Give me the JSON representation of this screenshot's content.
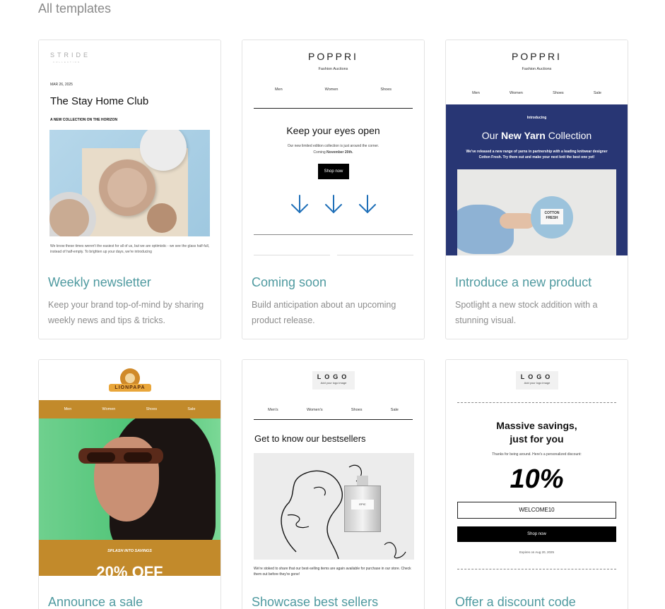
{
  "page": {
    "heading": "All templates"
  },
  "colors": {
    "title": "#4f9aa0",
    "description": "#8d8d8d",
    "navy": "#283674",
    "ochre": "#c28a2b",
    "arrow_blue": "#1e6fb8"
  },
  "templates": [
    {
      "title": "Weekly newsletter",
      "description": "Keep your brand top-of-mind by sharing weekly news and tips & tricks.",
      "preview": {
        "brand": "STRIDE",
        "brand_sub": "COLLECTION",
        "date": "MAR 26, 2025",
        "headline": "The Stay Home Club",
        "tagline": "A NEW COLLECTION ON THE HORIZON",
        "body": "We know these times weren't the easiest for all of us, but we are optimistic - we see the glass half-full, instead of half-empty. To brighten up your days, we're introducing"
      }
    },
    {
      "title": "Coming soon",
      "description": "Build anticipation about an upcoming product release.",
      "preview": {
        "logo": "POPPRI",
        "logo_sub": "Fashion Auctions",
        "nav": [
          "Men",
          "Women",
          "Shoes"
        ],
        "headline": "Keep your eyes open",
        "body_line1": "Our new limited edition collection is just around the corner.",
        "body_line2_prefix": "Coming ",
        "body_line2_bold": "November 20th.",
        "cta": "Shop now",
        "icon": "arrow-down-icon"
      }
    },
    {
      "title": "Introduce a new product",
      "description": "Spotlight a new stock addition with a stunning visual.",
      "preview": {
        "logo": "POPPRI",
        "logo_sub": "Fashion Auctions",
        "nav": [
          "Men",
          "Women",
          "Shoes",
          "Sale"
        ],
        "kicker": "Introducing",
        "headline_pre": "Our ",
        "headline_bold": "New Yarn",
        "headline_post": " Collection",
        "body": "We've released a new range of yarns in partnership with a leading knitwear designer Cotton Fresh. Try them out and make your next knit the best one yet!",
        "label_line1": "COTTON",
        "label_line2": "FRESH"
      }
    },
    {
      "title": "Announce a sale",
      "description": "",
      "preview": {
        "logo": "LIONPAPA",
        "nav": [
          "Men",
          "Women",
          "Shoes",
          "Sale"
        ],
        "kicker": "SPLASH INTO SAVINGS",
        "headline": "20% OFF"
      }
    },
    {
      "title": "Showcase best sellers",
      "description": "",
      "preview": {
        "logo": "LOGO",
        "logo_sub": "Add your logo image",
        "nav": [
          "Men's",
          "Women's",
          "Shoes",
          "Sale"
        ],
        "headline": "Get to know our bestsellers",
        "bottle_label": "EPIC",
        "body": "We're stoked to share that our best-selling items are again available for purchase in our store. Check them out before they're gone!"
      }
    },
    {
      "title": "Offer a discount code",
      "description": "",
      "preview": {
        "logo": "LOGO",
        "logo_sub": "Add your logo image",
        "headline_line1": "Massive savings,",
        "headline_line2": "just for you",
        "subtext": "Thanks for being around. Here's a personalized discount:",
        "percent": "10%",
        "code": "WELCOME10",
        "cta": "Shop now",
        "expiry": "Expires on Aug 20, 2025"
      }
    }
  ]
}
